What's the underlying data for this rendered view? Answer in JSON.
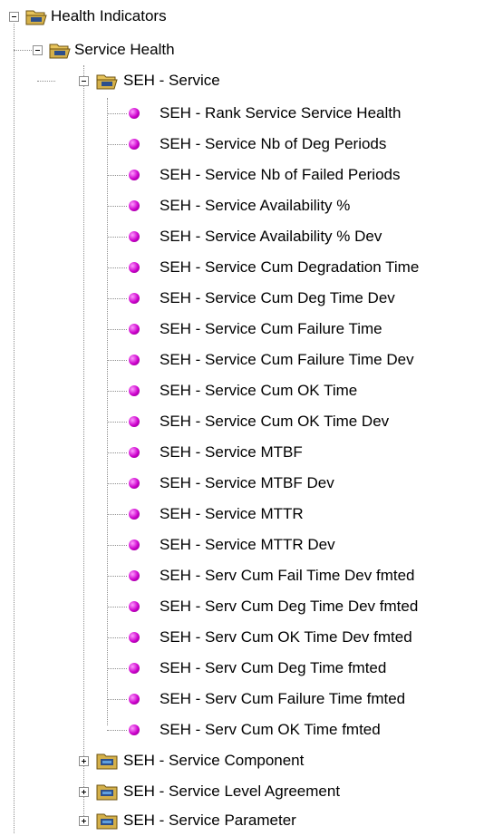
{
  "tree": {
    "root": {
      "label": "Health Indicators",
      "expanded": true,
      "icon": "open-folder-icon"
    },
    "service_health": {
      "label": "Service Health",
      "expanded": true,
      "icon": "open-folder-icon"
    },
    "seh_service": {
      "label": "SEH - Service",
      "expanded": true,
      "icon": "open-folder-icon",
      "items": [
        "SEH - Rank Service Service Health",
        "SEH - Service Nb of Deg Periods",
        "SEH - Service Nb of Failed Periods",
        "SEH - Service Availability %",
        "SEH - Service Availability % Dev",
        "SEH - Service Cum Degradation Time",
        "SEH - Service Cum Deg Time Dev",
        "SEH - Service Cum Failure Time",
        "SEH - Service Cum Failure Time Dev",
        "SEH - Service Cum OK Time",
        "SEH - Service Cum OK Time Dev",
        "SEH - Service MTBF",
        "SEH - Service MTBF Dev",
        "SEH - Service MTTR",
        "SEH - Service MTTR Dev",
        "SEH - Serv Cum Fail Time Dev fmted",
        "SEH - Serv Cum Deg Time Dev fmted",
        "SEH - Serv Cum OK Time Dev fmted",
        "SEH - Serv Cum Deg Time fmted",
        "SEH - Serv Cum Failure Time fmted",
        "SEH - Serv Cum OK Time fmted"
      ]
    },
    "collapsed_folders": [
      {
        "label": "SEH - Service Component",
        "icon": "closed-folder-icon"
      },
      {
        "label": "SEH - Service Level Agreement",
        "icon": "closed-folder-icon"
      },
      {
        "label": "SEH - Service Parameter",
        "icon": "closed-folder-icon"
      }
    ]
  },
  "colors": {
    "item_bullet": "#cc00cc",
    "tree_lines": "#8e8e8e",
    "folder": "#d4b04a"
  }
}
